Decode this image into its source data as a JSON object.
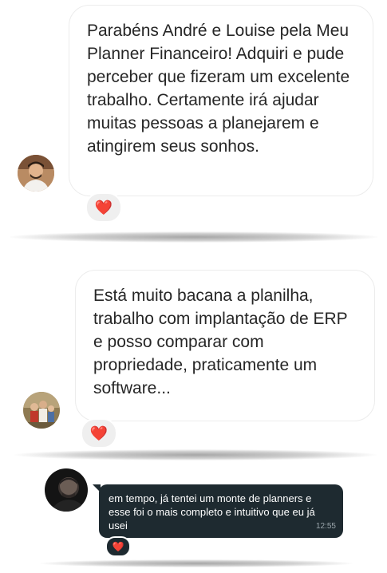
{
  "messages": [
    {
      "text": "Parabéns André e Louise pela Meu Planner Financeiro! Adquiri e pude perceber que fizeram um excelente trabalho. Certamente irá ajudar muitas pessoas a planejarem e atingirem seus sonhos.",
      "reaction": "❤️"
    },
    {
      "text": "Está muito bacana a planilha, trabalho com implantação de ERP e posso comparar com propriedade, praticamente um software...",
      "reaction": "❤️"
    },
    {
      "text": "em tempo, já tentei um monte de planners e esse foi o mais completo e intuitivo que eu já usei",
      "time": "12:55",
      "reaction": "❤️"
    }
  ],
  "colors": {
    "heart": "#e8243c",
    "dark_bubble": "#1e2a30"
  }
}
